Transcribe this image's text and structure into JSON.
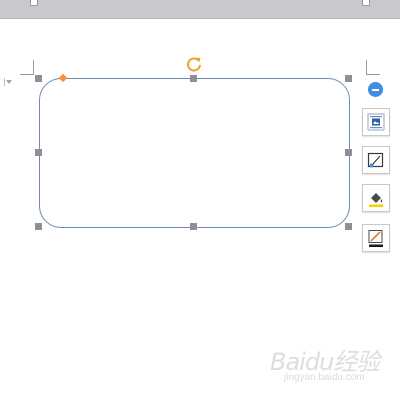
{
  "window": {
    "title_bar_color": "#c8c9ce"
  },
  "document": {
    "background": "#ffffff"
  },
  "selected_shape": {
    "type": "rounded-rectangle",
    "outline_color": "#6f8bad",
    "handle_color": "#8f8f94",
    "adjust_handle_color": "#f5913e",
    "rotate_handle_color": "#f0a030"
  },
  "side_toolbar": {
    "collapse_icon": "minus-circle-icon",
    "buttons": [
      {
        "icon": "layout-wrap-icon"
      },
      {
        "icon": "shape-style-icon"
      },
      {
        "icon": "fill-color-icon",
        "color": "#f7d200"
      },
      {
        "icon": "outline-color-icon",
        "color": "#1a1a1a"
      }
    ]
  },
  "watermark": {
    "logo_text": "Baidu经验",
    "url": "jingyan.baidu.com"
  }
}
